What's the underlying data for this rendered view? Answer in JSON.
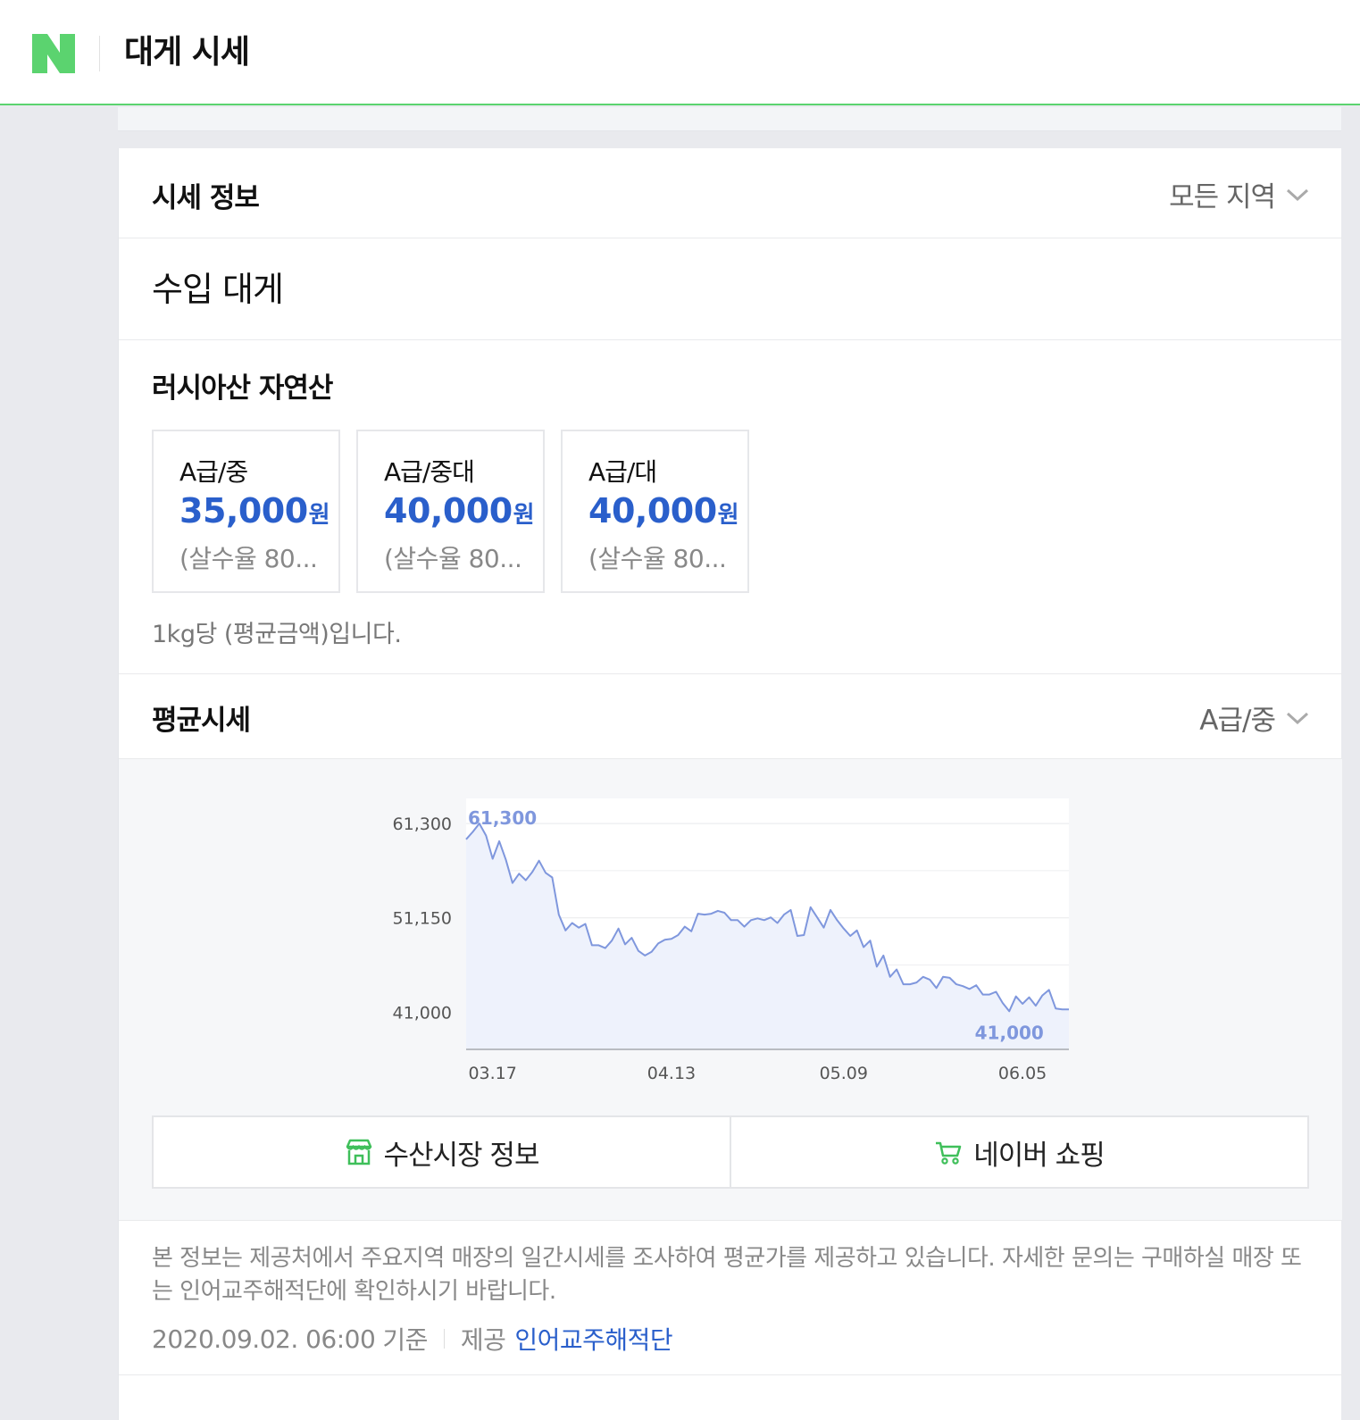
{
  "header": {
    "title": "대게 시세",
    "logo_icon": "naver-n-logo",
    "brand_color": "#5bd36f"
  },
  "info": {
    "title": "시세 정보",
    "region_select": "모든 지역"
  },
  "product": {
    "name": "수입 대게",
    "origin": "러시아산 자연산"
  },
  "grades": [
    {
      "name": "A급/중",
      "price": "35,000",
      "unit": "원",
      "note": "(살수율 80..."
    },
    {
      "name": "A급/중대",
      "price": "40,000",
      "unit": "원",
      "note": "(살수율 80..."
    },
    {
      "name": "A급/대",
      "price": "40,000",
      "unit": "원",
      "note": "(살수율 80..."
    }
  ],
  "per_kg_note": "1kg당 (평균금액)입니다.",
  "avg": {
    "title": "평균시세",
    "grade_select": "A급/중"
  },
  "chart_data": {
    "type": "line",
    "y_ticks": [
      "61,300",
      "51,150",
      "41,000"
    ],
    "ylim": [
      37000,
      64000
    ],
    "x_ticks": [
      "03.17",
      "04.13",
      "05.09",
      "06.05"
    ],
    "x_tick_index": [
      4,
      31,
      57,
      84
    ],
    "max_label": "61,300",
    "min_label": "41,000",
    "line_color": "#7f97dd",
    "fill_color": "#eef2fc",
    "values": [
      59600,
      60400,
      61300,
      60000,
      57500,
      59400,
      57400,
      54900,
      55900,
      55200,
      56100,
      57300,
      56000,
      55500,
      51500,
      49800,
      50600,
      50100,
      50500,
      48200,
      48200,
      47900,
      48700,
      50000,
      48300,
      49000,
      47600,
      47100,
      47500,
      48400,
      48800,
      48900,
      49300,
      50200,
      49700,
      51600,
      51500,
      51600,
      51900,
      51700,
      50900,
      50900,
      50200,
      50900,
      51100,
      50900,
      51200,
      50600,
      51500,
      52000,
      49200,
      49300,
      52300,
      51200,
      50100,
      52000,
      50900,
      50000,
      49200,
      49800,
      48000,
      48700,
      45900,
      47100,
      44800,
      45600,
      44000,
      44000,
      44200,
      44800,
      44500,
      43600,
      44800,
      44700,
      44000,
      43800,
      43500,
      43900,
      42900,
      42900,
      43200,
      42000,
      41100,
      42700,
      41900,
      42600,
      41700,
      42800,
      43400,
      41400,
      41300,
      41300
    ]
  },
  "links": [
    {
      "label": "수산시장 정보",
      "icon": "market-store-icon"
    },
    {
      "label": "네이버 쇼핑",
      "icon": "shopping-cart-icon"
    }
  ],
  "footer": {
    "description": "본 정보는 제공처에서 주요지역 매장의 일간시세를 조사하여 평균가를 제공하고 있습니다. 자세한 문의는 구매하실 매장 또는 인어교주해적단에 확인하시기 바랍니다.",
    "date": "2020.09.02. 06:00",
    "date_suffix": "기준",
    "provider_label": "제공",
    "provider": "인어교주해적단"
  }
}
